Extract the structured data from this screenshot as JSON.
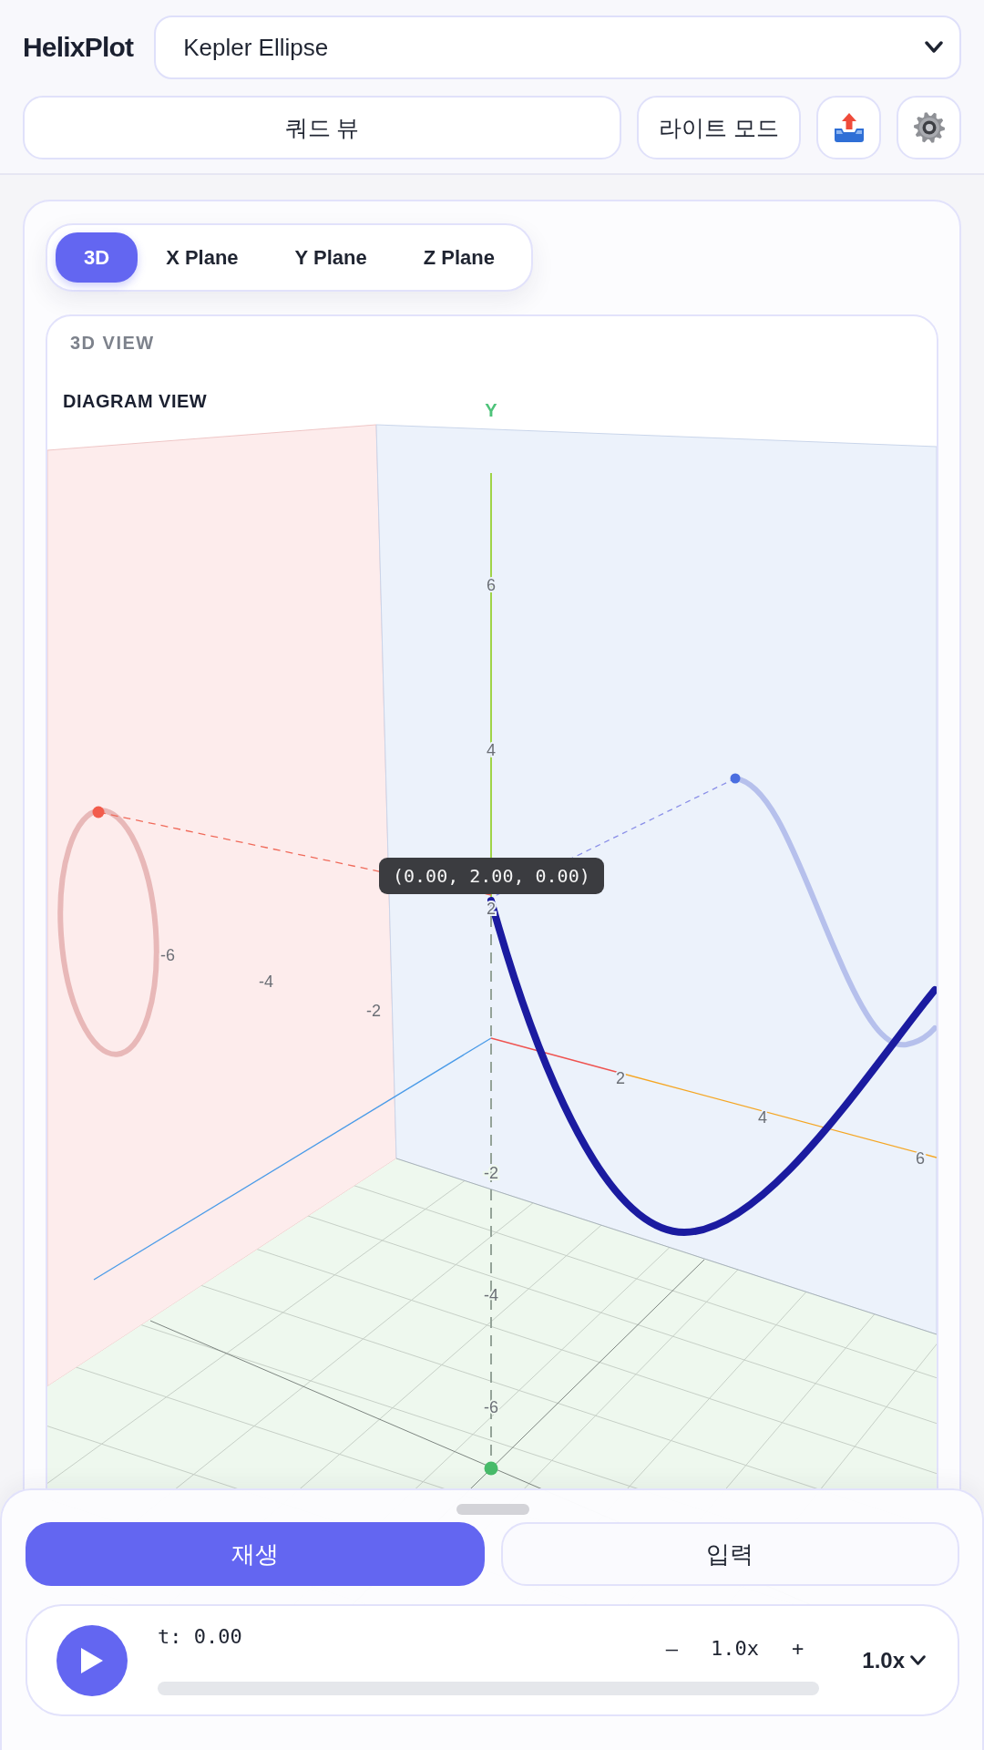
{
  "app": {
    "title": "HelixPlot",
    "preset": "Kepler Ellipse"
  },
  "toolbar": {
    "view_toggle": "쿼드 뷰",
    "theme_toggle": "라이트 모드",
    "icon_buttons": [
      {
        "kind": "export"
      },
      {
        "kind": "settings"
      }
    ]
  },
  "view_tabs": [
    {
      "label": "3D",
      "selected": true
    },
    {
      "label": "X Plane",
      "selected": false
    },
    {
      "label": "Y Plane",
      "selected": false
    },
    {
      "label": "Z Plane",
      "selected": false
    }
  ],
  "view_panel": {
    "title": "3D VIEW",
    "canvas_label": "DIAGRAM VIEW",
    "axis_label": "Y",
    "y_ticks": [
      "6",
      "4",
      "2",
      "-2",
      "-4",
      "-6"
    ],
    "x_ticks": [
      "2",
      "4",
      "6"
    ],
    "z_ticks": [
      "-6",
      "-4",
      "-2"
    ],
    "tooltip": "(0.00, 2.00, 0.00)"
  },
  "bottom_sheet": {
    "modes": [
      {
        "label": "재생",
        "selected": true
      },
      {
        "label": "입력",
        "selected": false
      }
    ],
    "player": {
      "playing": false,
      "time": "t: 0.00",
      "level": 0,
      "step_down": "–",
      "speed": "1.0x",
      "step_up": "+",
      "speed_select": "1.0x"
    }
  }
}
